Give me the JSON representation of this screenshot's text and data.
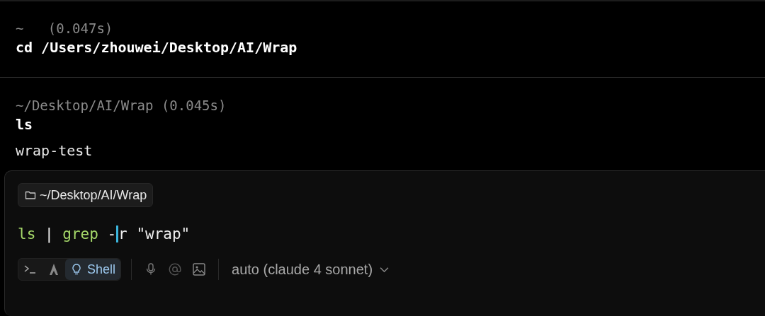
{
  "blocks": [
    {
      "header": "~   (0.047s)",
      "command": "cd /Users/zhouwei/Desktop/AI/Wrap"
    },
    {
      "header": "~/Desktop/AI/Wrap (0.045s)",
      "command": "ls",
      "output": "wrap-test"
    }
  ],
  "input": {
    "directory": "~/Desktop/AI/Wrap",
    "tokens": [
      {
        "kind": "command",
        "text": "ls"
      },
      {
        "kind": "plain",
        "text": " | "
      },
      {
        "kind": "command",
        "text": "grep"
      },
      {
        "kind": "plain",
        "text": " -"
      },
      {
        "kind": "cursor"
      },
      {
        "kind": "plain",
        "text": "r \"wrap\""
      }
    ],
    "modes": [
      {
        "kind": "terminal",
        "selected": false
      },
      {
        "kind": "agent",
        "selected": false
      },
      {
        "kind": "shell",
        "label": "Shell",
        "selected": true
      }
    ],
    "model": "auto (claude 4 sonnet)"
  }
}
